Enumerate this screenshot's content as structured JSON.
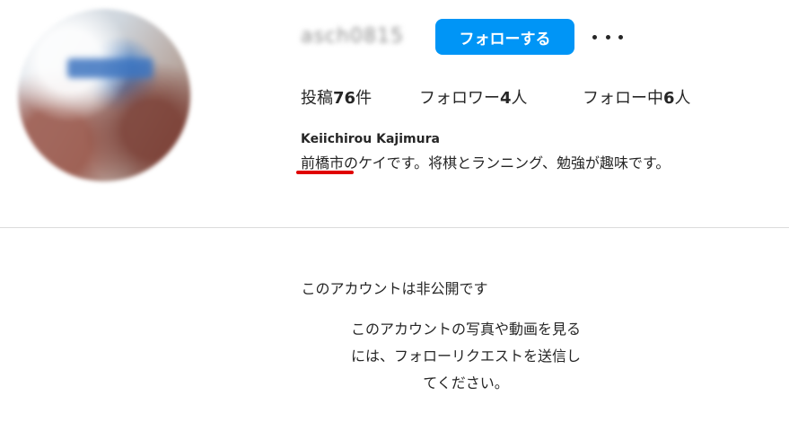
{
  "profile": {
    "username": "asch0815",
    "follow_label": "フォローする",
    "more_icon": "more-horizontal-icon",
    "accent_color": "#0095f6",
    "stats": {
      "posts_prefix": "投稿",
      "posts_count": "76",
      "posts_suffix": "件",
      "followers_prefix": "フォロワー",
      "followers_count": "4",
      "followers_suffix": "人",
      "following_prefix": "フォロー中",
      "following_count": "6",
      "following_suffix": "人"
    },
    "full_name": "Keiichirou Kajimura",
    "bio": "前橋市のケイです。将棋とランニング、勉強が趣味です。",
    "highlight_color": "#e00000"
  },
  "private_notice": {
    "title": "このアカウントは非公開です",
    "body_line1": "このアカウントの写真や動画を見る",
    "body_line2": "には、フォローリクエストを送信し",
    "body_line3": "てください。"
  }
}
